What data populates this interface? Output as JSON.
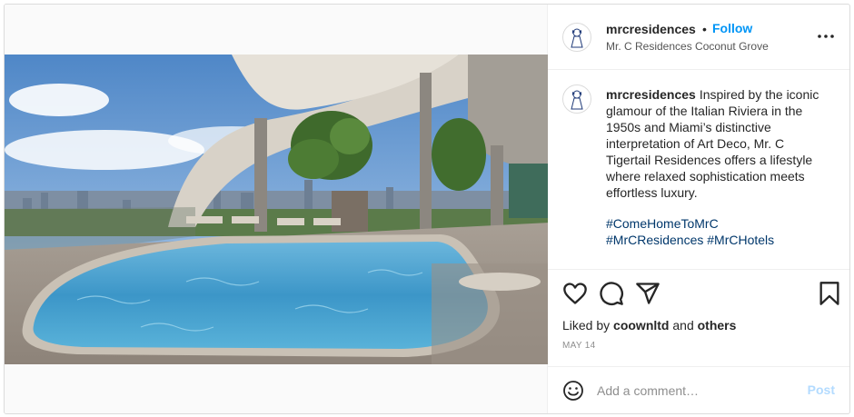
{
  "post": {
    "username": "mrcresidences",
    "follow_label": "Follow",
    "separator": "•",
    "location": "Mr. C Residences Coconut Grove",
    "caption_text": "Inspired by the iconic glamour of the Italian Riviera in the 1950s and Miami’s distinctive interpretation of Art Deco, Mr. C Tigertail Residences offers a lifestyle where relaxed sophistication meets effortless luxury.",
    "hashtags": [
      "#ComeHomeToMrC",
      "#MrCResidences",
      "#MrCHotels"
    ],
    "liked_prefix": "Liked by ",
    "liked_user": "coownltd",
    "liked_and": " and ",
    "liked_others": "others",
    "date": "MAY 14",
    "comment_placeholder": "Add a comment…",
    "post_label": "Post"
  },
  "icons": {
    "more": "more-options-icon",
    "like": "heart-icon",
    "comment": "comment-icon",
    "share": "share-icon",
    "save": "bookmark-icon",
    "emoji": "emoji-icon"
  },
  "colors": {
    "follow": "#0095f6",
    "post_disabled": "#b3dbff",
    "hashtag": "#00376b",
    "border": "#dbdbdb"
  }
}
